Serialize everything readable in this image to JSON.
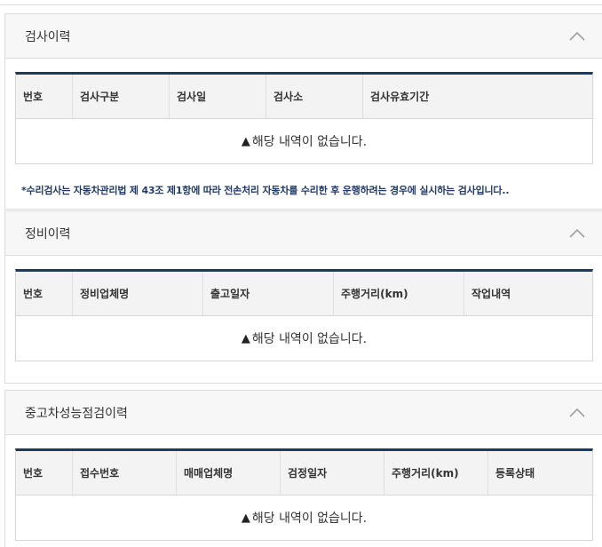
{
  "sections": [
    {
      "title": "검사이력",
      "columns": [
        "번호",
        "검사구분",
        "검사일",
        "검사소",
        "검사유효기간"
      ],
      "empty_text": "해당 내역이 없습니다.",
      "note": "*수리검사는 자동차관리법 제 43조 제1항에 따라 전손처리 자동차를 수리한 후 운행하려는 경우에 실시하는 검사입니다.."
    },
    {
      "title": "정비이력",
      "columns": [
        "번호",
        "정비업체명",
        "출고일자",
        "주행거리(km)",
        "작업내역"
      ],
      "empty_text": "해당 내역이 없습니다."
    },
    {
      "title": "중고차성능점검이력",
      "columns": [
        "번호",
        "접수번호",
        "매매업체명",
        "검정일자",
        "주행거리(km)",
        "등록상태"
      ],
      "empty_text": "해당 내역이 없습니다."
    }
  ],
  "colors": {
    "header_rule": "#1d3b5c",
    "note_text": "#1f3a6b"
  },
  "icons": {
    "collapse": "chevron-up-icon",
    "empty": "warning-icon"
  }
}
